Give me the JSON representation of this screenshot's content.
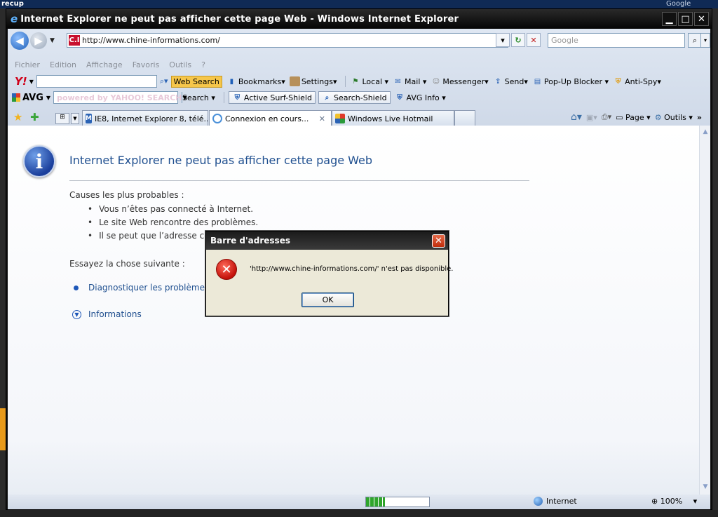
{
  "window": {
    "title": "Internet Explorer ne peut pas afficher cette page Web - Windows Internet Explorer",
    "minimize_label": "▁",
    "maximize_label": "□",
    "close_label": "✕"
  },
  "address_bar": {
    "url": "http://www.chine-informations.com/",
    "site_logo_text": "C.I",
    "search_placeholder": "Google"
  },
  "menu": [
    "Fichier",
    "Edition",
    "Affichage",
    "Favoris",
    "Outils",
    "?"
  ],
  "yahoo_toolbar": {
    "logo": "Y!",
    "web_search": "Web Search",
    "items": [
      "Bookmarks",
      "Settings",
      "Local",
      "Mail",
      "Messenger",
      "Send",
      "Pop-Up Blocker",
      "Anti-Spy"
    ]
  },
  "avg_toolbar": {
    "logo": "AVG",
    "yahoo_search_text": "powered by YAHOO! SEARCH",
    "search_label": "Search",
    "active_surf_shield": "Active  Surf-Shield",
    "search_shield": "Search-Shield",
    "avg_info": "AVG Info"
  },
  "tabs": [
    {
      "label": "IE8, Internet Explorer 8, télé..."
    },
    {
      "label": "Connexion en cours..."
    },
    {
      "label": "Windows Live Hotmail"
    }
  ],
  "command_bar": {
    "page_label": "Page",
    "tools_label": "Outils"
  },
  "content": {
    "title": "Internet Explorer ne peut pas afficher cette page Web",
    "causes_heading": "Causes les plus probables :",
    "causes": [
      "Vous n’êtes pas connecté à Internet.",
      "Le site Web rencontre des problèmes.",
      "Il se peut que l’adresse contienne une erreur de frappe."
    ],
    "try_heading": "Essayez la chose suivante :",
    "diagnose_link": "Diagnostiquer les problèmes",
    "info_link": "Informations"
  },
  "dialog": {
    "title": "Barre d'adresses",
    "message": "'http://www.chine-informations.com/' n'est pas disponible.",
    "ok_label": "OK"
  },
  "status_bar": {
    "progress": 0.3,
    "zone": "Internet",
    "zoom": "100%"
  },
  "desktop": {
    "top_left_label": "recup",
    "top_right_label": "Google"
  },
  "colors": {
    "link": "#1f4f8f",
    "titlebar": "#050505",
    "error_red": "#c3110a"
  }
}
